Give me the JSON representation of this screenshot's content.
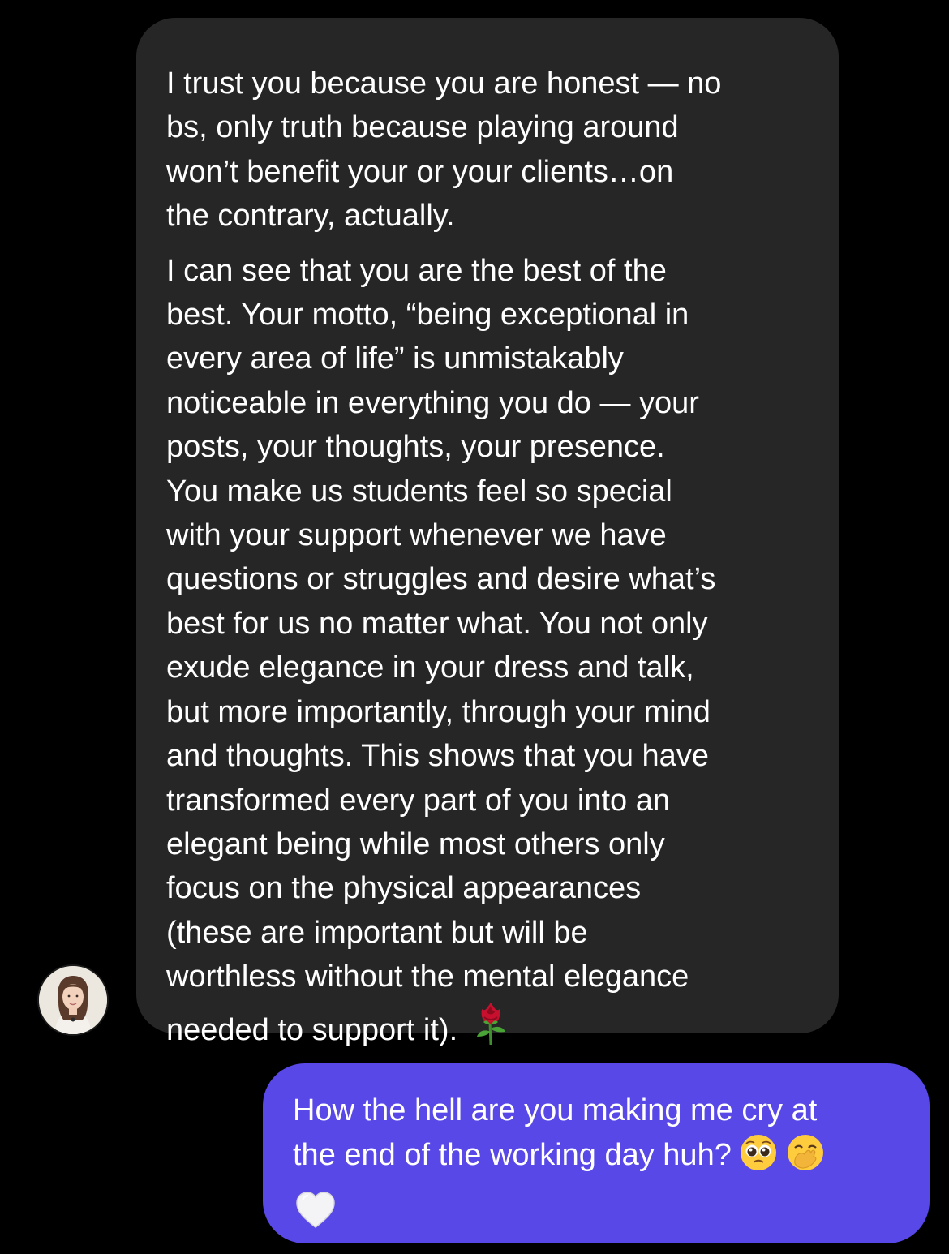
{
  "thread": {
    "incoming": {
      "paragraphs": [
        "I trust you because you are honest — no\nbs, only truth because playing around\nwon’t benefit your or your clients…on\nthe contrary, actually.",
        " I can see that you are the best of the\nbest. Your motto, “being exceptional in\nevery area of life” is unmistakably\nnoticeable in everything you do — your\nposts, your thoughts, your presence.\nYou make us students feel so special\nwith your support whenever we have\nquestions or struggles and desire what’s\nbest for us no matter what. You not only\nexude elegance in your dress and talk,\nbut more importantly, through your mind\nand thoughts. This shows that you have\ntransformed every part of you into an\nelegant being while most others only\nfocus on the physical appearances\n(these are important but will be\nworthless without the mental elegance\nneeded to support it)."
      ],
      "trailing_emoji": "rose-emoji",
      "bubble_color": "#262626"
    },
    "outgoing": {
      "text": "How the hell are you making me cry at\nthe end of the working day huh?",
      "trailing_emojis": [
        "pleading-face-emoji",
        "face-with-hand-over-mouth-emoji"
      ],
      "second_line_emoji": "white-heart-emoji",
      "bubble_color": "#5948e8"
    },
    "avatar": "contact-avatar"
  }
}
